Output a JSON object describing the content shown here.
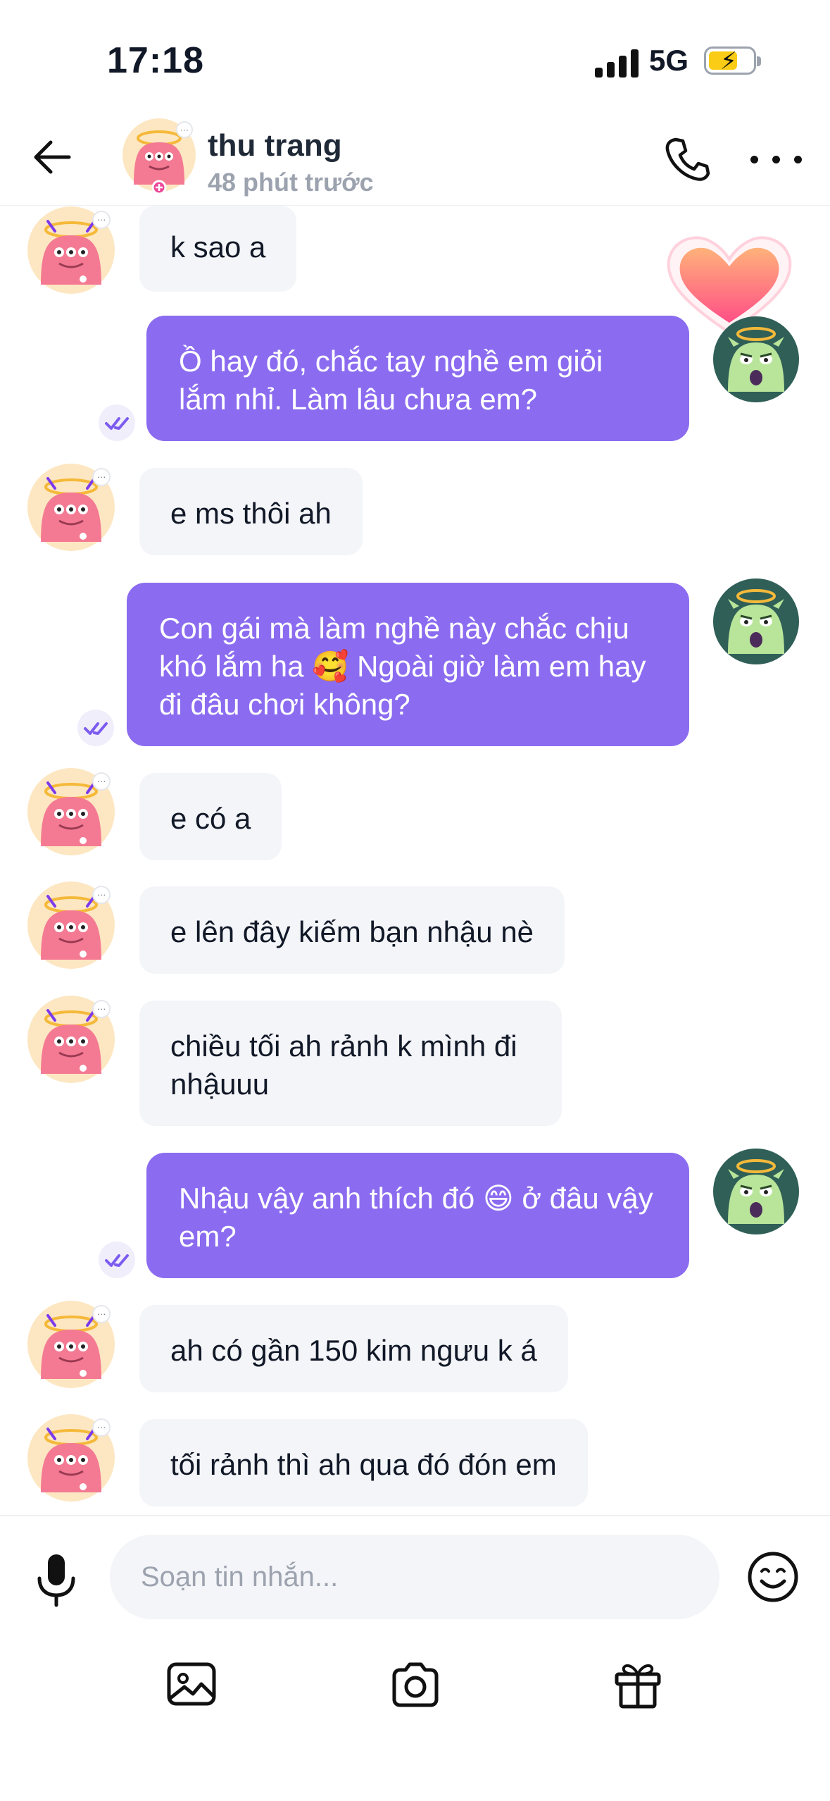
{
  "status_bar": {
    "time": "17:18",
    "network": "5G"
  },
  "header": {
    "name": "thu trang",
    "status": "48 phút trước"
  },
  "messages": [
    {
      "text": "k sao a"
    },
    {
      "text": "Ồ hay đó, chắc tay nghề em giỏi lắm nhỉ. Làm lâu chưa em?"
    },
    {
      "text": "e ms thôi ah"
    },
    {
      "text": "Con gái mà làm nghề này chắc chịu khó lắm ha 🥰 Ngoài giờ làm em hay đi đâu chơi không?"
    },
    {
      "text": "e có a"
    },
    {
      "text": "e lên đây kiếm bạn nhậu nè"
    },
    {
      "text": "chiều tối ah rảnh k mình đi nhậuuu"
    },
    {
      "text": "Nhậu vậy anh thích đó 😄 ở đâu vậy em?"
    },
    {
      "text": "ah có gần 150 kim ngưu k á"
    },
    {
      "text": "tối rảnh thì ah qua đó đón em"
    }
  ],
  "composer": {
    "placeholder": "Soạn tin nhắn...",
    "value": ""
  },
  "icons": {
    "back": "arrow-left-icon",
    "call": "phone-icon",
    "more": "more-dots-icon",
    "mic": "microphone-icon",
    "emoji": "emoji-icon",
    "gallery": "gallery-icon",
    "camera": "camera-icon",
    "gift": "gift-icon",
    "seen": "double-check-icon"
  },
  "colors": {
    "outgoing_bubble": "#8b6cf0",
    "incoming_bubble": "#f4f5f8",
    "accent": "#7c5cf0"
  }
}
